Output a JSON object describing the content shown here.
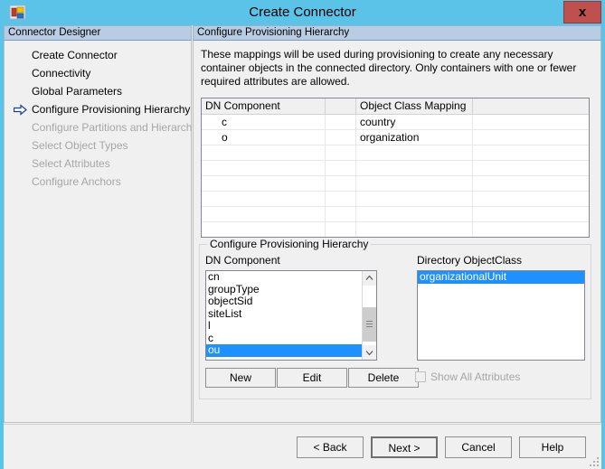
{
  "window": {
    "title": "Create Connector",
    "icon": "connector-icon",
    "close_label": "x",
    "accent_color": "#5bc3e8",
    "close_color": "#c0504d"
  },
  "sidebar": {
    "header": "Connector Designer",
    "items": [
      {
        "label": "Create Connector",
        "state": "done",
        "current": false
      },
      {
        "label": "Connectivity",
        "state": "done",
        "current": false
      },
      {
        "label": "Global Parameters",
        "state": "done",
        "current": false
      },
      {
        "label": "Configure Provisioning Hierarchy",
        "state": "current",
        "current": true
      },
      {
        "label": "Configure Partitions and Hierarchies",
        "state": "disabled",
        "current": false
      },
      {
        "label": "Select Object Types",
        "state": "disabled",
        "current": false
      },
      {
        "label": "Select Attributes",
        "state": "disabled",
        "current": false
      },
      {
        "label": "Configure Anchors",
        "state": "disabled",
        "current": false
      }
    ]
  },
  "content": {
    "header": "Configure Provisioning Hierarchy",
    "description": "These mappings will be used during provisioning to create any necessary container objects in the connected directory.  Only containers with one or fewer required attributes are allowed.",
    "grid": {
      "columns": [
        "DN Component",
        "",
        "Object Class Mapping",
        ""
      ],
      "rows": [
        [
          "c",
          "",
          "country",
          ""
        ],
        [
          "o",
          "",
          "organization",
          ""
        ]
      ],
      "empty_rows": 7
    },
    "groupbox": {
      "legend": "Configure Provisioning Hierarchy",
      "dn_label": "DN Component",
      "dn_items": [
        "cn",
        "groupType",
        "objectSid",
        "siteList",
        "l",
        "c",
        "ou"
      ],
      "dn_selected": "ou",
      "objectclass_label": "Directory ObjectClass",
      "objectclass_items": [
        "organizationalUnit"
      ],
      "objectclass_selected": "organizationalUnit",
      "selection_color": "#1e90ff",
      "buttons": [
        {
          "label": "New",
          "enabled": true
        },
        {
          "label": "Edit",
          "enabled": true
        },
        {
          "label": "Delete",
          "enabled": true
        }
      ],
      "checkbox": {
        "label": "Show All Attributes",
        "checked": false,
        "enabled": false
      }
    }
  },
  "footer": {
    "buttons": [
      {
        "label": "< Back",
        "default": false
      },
      {
        "label": "Next  >",
        "default": true
      },
      {
        "label": "Cancel",
        "default": false
      },
      {
        "label": "Help",
        "default": false
      }
    ]
  }
}
